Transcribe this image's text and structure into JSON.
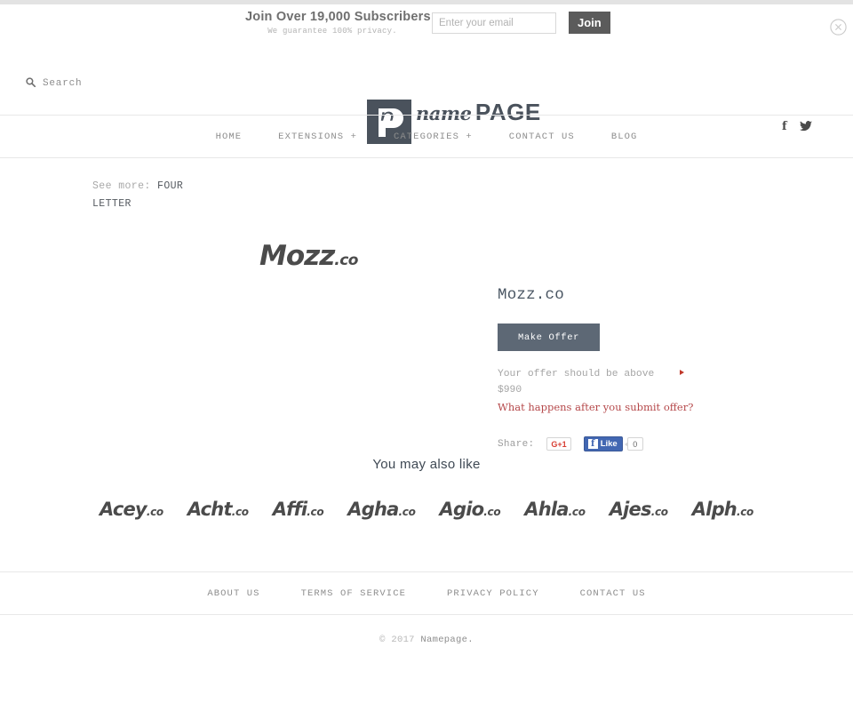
{
  "promo": {
    "title": "Join Over 19,000 Subscribers",
    "subtitle": "We guarantee 100% privacy.",
    "email_placeholder": "Enter your email",
    "email_value": "",
    "join_label": "Join",
    "close_icon": "close-circle-icon"
  },
  "header": {
    "search_label": "Search",
    "search_icon": "search-icon",
    "logo_name": "name",
    "logo_page": "PAGE",
    "social": [
      {
        "name": "facebook-icon",
        "glyph": "f"
      },
      {
        "name": "twitter-icon",
        "glyph": "t"
      }
    ]
  },
  "nav": {
    "items": [
      {
        "label": "HOME"
      },
      {
        "label": "EXTENSIONS +"
      },
      {
        "label": "CATEGORIES +"
      },
      {
        "label": "CONTACT US"
      },
      {
        "label": "BLOG"
      }
    ]
  },
  "breadcrumb": {
    "prefix": "See more:",
    "category": "FOUR LETTER"
  },
  "product": {
    "logo_name": "Mozz",
    "logo_tld": ".co",
    "title": "Mozz.co",
    "make_offer_label": "Make Offer",
    "offer_note": "Your offer should be above $990",
    "offer_minimum": "$990",
    "offer_link": "What happens after you submit offer?",
    "share_label": "Share:",
    "gplus_label": "G+1",
    "fb_like_label": "Like",
    "fb_like_count": "0"
  },
  "also_like": {
    "title": "You may also like",
    "items": [
      {
        "name": "Acey",
        "tld": ".co"
      },
      {
        "name": "Acht",
        "tld": ".co"
      },
      {
        "name": "Affi",
        "tld": ".co"
      },
      {
        "name": "Agha",
        "tld": ".co"
      },
      {
        "name": "Agio",
        "tld": ".co"
      },
      {
        "name": "Ahla",
        "tld": ".co"
      },
      {
        "name": "Ajes",
        "tld": ".co"
      },
      {
        "name": "Alph",
        "tld": ".co"
      }
    ]
  },
  "footer": {
    "links": [
      {
        "label": "ABOUT US"
      },
      {
        "label": "TERMS OF SERVICE"
      },
      {
        "label": "PRIVACY POLICY"
      },
      {
        "label": "CONTACT US"
      }
    ],
    "copyright_prefix": "© 2017 ",
    "copyright_brand": "Namepage."
  },
  "colors": {
    "accent_slate": "#5d6875",
    "link_red": "#b5484a",
    "brand_dark": "#4a525c"
  }
}
